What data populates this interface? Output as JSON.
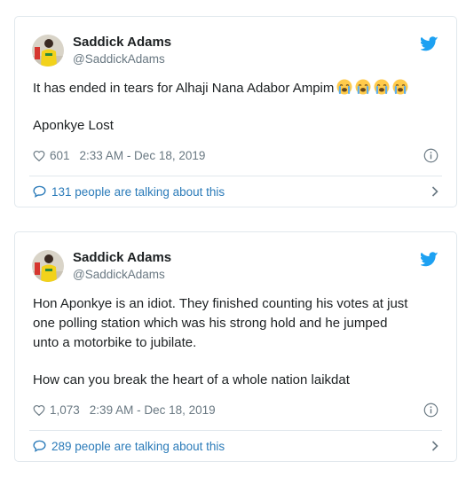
{
  "colors": {
    "link": "#2b7bb9",
    "muted": "#697882",
    "text": "#1c2022",
    "border": "#e1e8ed",
    "twitter_blue": "#1da1f2"
  },
  "tweets": [
    {
      "author": {
        "name": "Saddick Adams",
        "handle": "@SaddickAdams"
      },
      "text_lines": [
        "It has ended in tears for Alhaji Nana Adabor Ampim",
        "",
        "Aponkye Lost"
      ],
      "emoji": [
        "loudly-crying-face",
        "loudly-crying-face",
        "loudly-crying-face",
        "loudly-crying-face"
      ],
      "likes": "601",
      "timestamp": "2:33 AM - Dec 18, 2019",
      "talking": "131 people are talking about this"
    },
    {
      "author": {
        "name": "Saddick Adams",
        "handle": "@SaddickAdams"
      },
      "text_lines": [
        "Hon Aponkye is an idiot. They finished counting his votes at just",
        "one polling station which was his strong hold and he jumped",
        "unto a motorbike to jubilate.",
        "",
        "How can you break the heart of a whole nation laikdat"
      ],
      "likes": "1,073",
      "timestamp": "2:39 AM - Dec 18, 2019",
      "talking": "289 people are talking about this"
    }
  ]
}
